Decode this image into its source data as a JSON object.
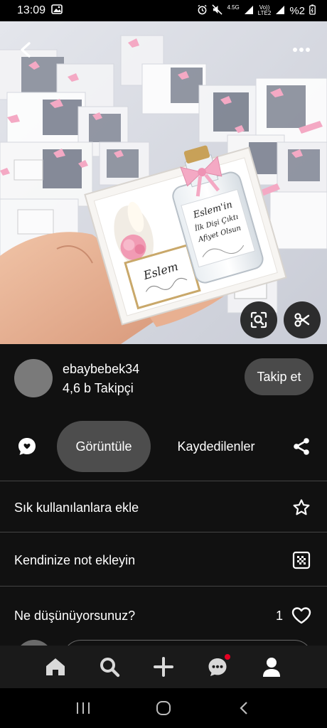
{
  "status_bar": {
    "time": "13:09",
    "network_top": "4.5G",
    "network_bottom": "LTE2",
    "volte": "Vo))",
    "battery": "%2",
    "icons": [
      "image-icon",
      "alarm-icon",
      "mute-icon",
      "signal-icon",
      "battery-icon"
    ]
  },
  "hero": {
    "label_small": "Eslem",
    "label_bottle": [
      "Eslem'in",
      "İlk Dişi Çıktı",
      "Afiyet Olsun"
    ],
    "icons": [
      "back-arrow-icon",
      "more-icon",
      "visual-search-icon",
      "scissors-icon"
    ],
    "colors": {
      "ribbon": "#f4a9c4",
      "box": "#f5f3ef",
      "bg": "#d8dbe3"
    }
  },
  "creator": {
    "name": "ebaybebek34",
    "followers": "4,6 b Takipçi",
    "follow_label": "Takip et"
  },
  "tabs": {
    "view_label": "Görüntüle",
    "saved_label": "Kaydedilenler"
  },
  "rows": {
    "favorites": "Sık kullanılanlara ekle",
    "note": "Kendinize not ekleyin",
    "comments": "Ne düşünüyorsunuz?",
    "like_count": "1"
  },
  "bottom_nav": {
    "items": [
      "home-icon",
      "search-icon",
      "add-icon",
      "messages-icon",
      "profile-icon"
    ],
    "has_notification": true,
    "notification_color": "#e60023"
  }
}
